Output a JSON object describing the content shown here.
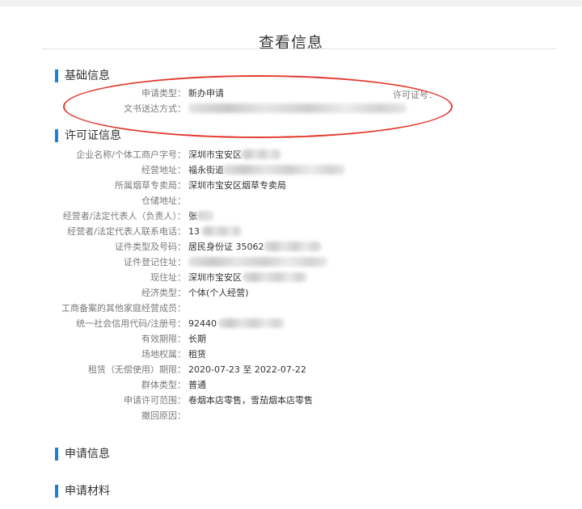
{
  "page": {
    "title": "查看信息"
  },
  "basic_info": {
    "heading": "基础信息",
    "application_type_label": "申请类型：",
    "application_type_value": "新办申请",
    "permit_no_label": "许可证号：",
    "delivery_method_label": "文书送达方式："
  },
  "license_info": {
    "heading": "许可证信息",
    "rows": [
      {
        "label": "企业名称/个体工商户字号：",
        "value": "深圳市宝安区"
      },
      {
        "label": "经营地址：",
        "value": "福永街道"
      },
      {
        "label": "所属烟草专卖局：",
        "value": "深圳市宝安区烟草专卖局"
      },
      {
        "label": "仓储地址：",
        "value": ""
      },
      {
        "label": "经营者/法定代表人（负责人）：",
        "value": "张"
      },
      {
        "label": "经营者/法定代表人联系电话：",
        "value": "13"
      },
      {
        "label": "证件类型及号码：",
        "value": "居民身份证 35062"
      },
      {
        "label": "证件登记住址：",
        "value": ""
      },
      {
        "label": "现住址：",
        "value": "深圳市宝安区"
      },
      {
        "label": "经济类型：",
        "value": "个体(个人经营)"
      },
      {
        "label": "工商备案的其他家庭经营成员：",
        "value": ""
      },
      {
        "label": "统一社会信用代码/注册号：",
        "value": "92440"
      },
      {
        "label": "有效期限：",
        "value": "长期"
      },
      {
        "label": "场地权属：",
        "value": "租赁"
      },
      {
        "label": "租赁（无偿使用）期限：",
        "value": "2020-07-23 至 2022-07-22"
      },
      {
        "label": "群体类型：",
        "value": "普通"
      },
      {
        "label": "申请许可范围：",
        "value": "卷烟本店零售，雪茄烟本店零售"
      },
      {
        "label": "撤回原因：",
        "value": ""
      }
    ]
  },
  "application_info": {
    "heading": "申请信息"
  },
  "application_materials": {
    "heading": "申请材料"
  }
}
